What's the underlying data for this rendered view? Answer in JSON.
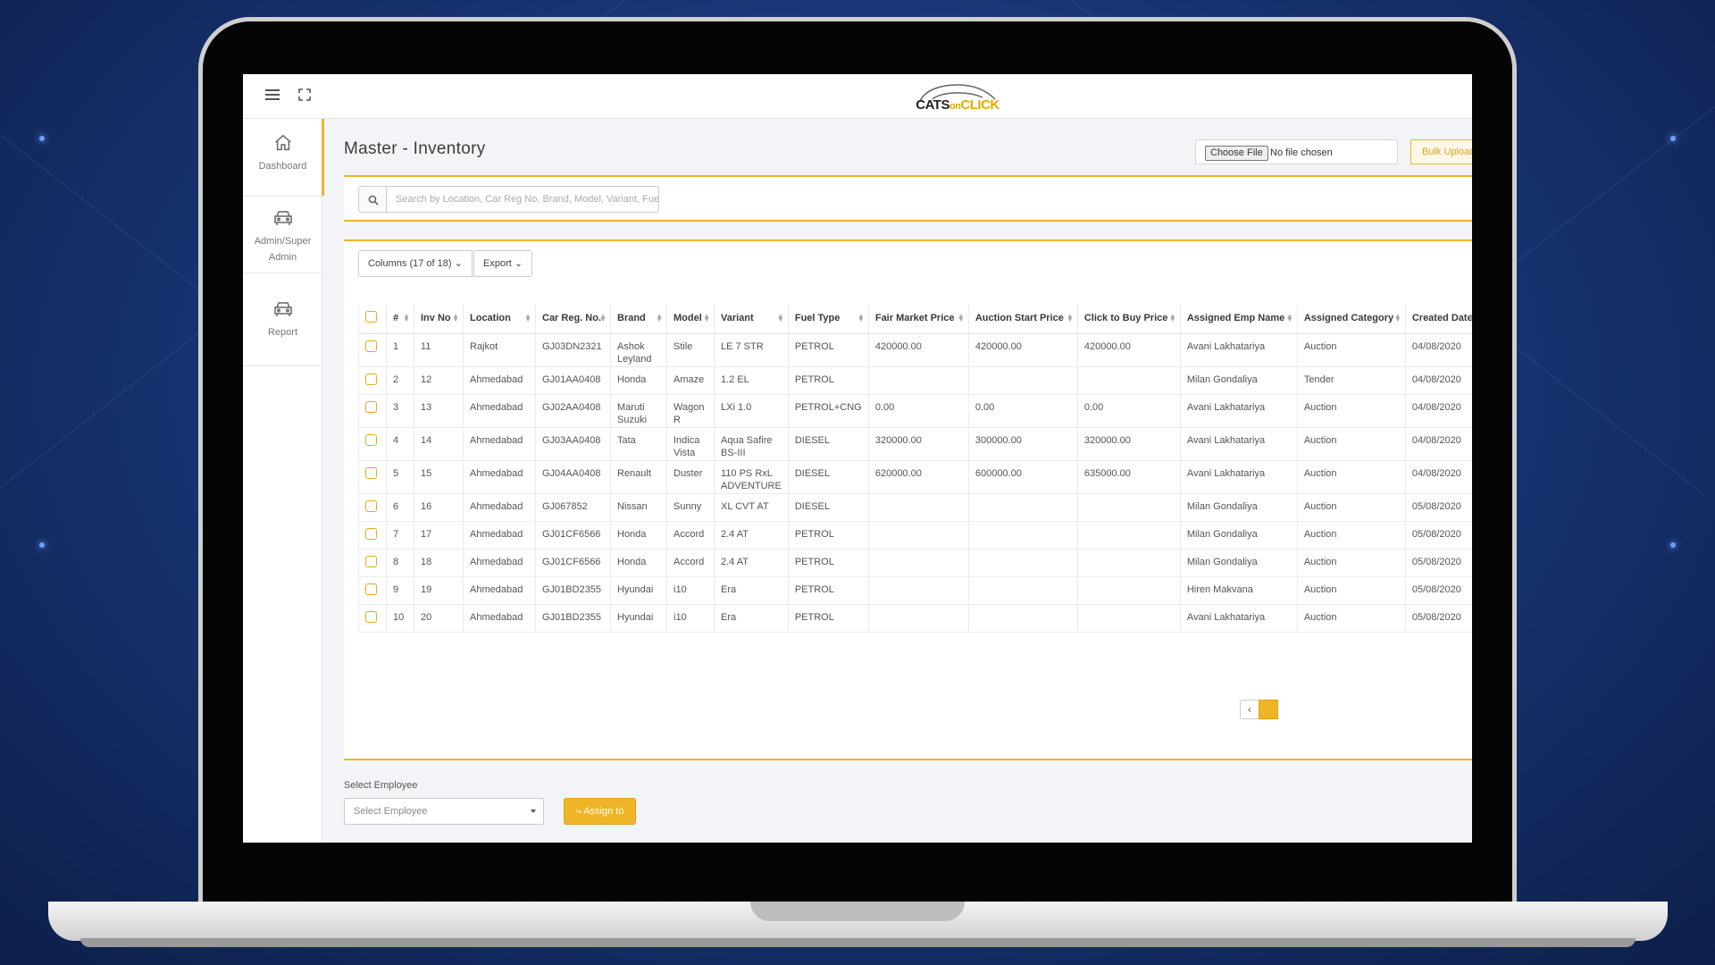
{
  "app": {
    "logo_text_part1": "CATS",
    "logo_text_part2": "on",
    "logo_text_part3": "CLICK"
  },
  "sidebar": {
    "items": [
      {
        "label": "Dashboard",
        "icon": "home-icon"
      },
      {
        "label": "Admin/Super Admin",
        "icon": "car-icon"
      },
      {
        "label": "Report",
        "icon": "car-icon"
      }
    ]
  },
  "page": {
    "title": "Master - Inventory",
    "file_button": "Choose File",
    "file_status": "No file chosen",
    "bulk_upload": "Bulk Upload"
  },
  "search": {
    "placeholder": "Search by Location, Car Reg No, Brand, Model, Variant, Fue"
  },
  "toolbar": {
    "columns_label": "Columns (17 of 18)",
    "export_label": "Export"
  },
  "table": {
    "headers": [
      "#",
      "Inv No",
      "Location",
      "Car Reg. No.",
      "Brand",
      "Model",
      "Variant",
      "Fuel Type",
      "Fair Market Price",
      "Auction Start Price",
      "Click to Buy Price",
      "Assigned Emp Name",
      "Assigned Category",
      "Created Date"
    ],
    "rows": [
      [
        "1",
        "11",
        "Rajkot",
        "GJ03DN2321",
        "Ashok Leyland",
        "Stile",
        "LE 7 STR",
        "PETROL",
        "420000.00",
        "420000.00",
        "420000.00",
        "Avani Lakhatariya",
        "Auction",
        "04/08/2020"
      ],
      [
        "2",
        "12",
        "Ahmedabad",
        "GJ01AA0408",
        "Honda",
        "Amaze",
        "1.2 EL",
        "PETROL",
        "",
        "",
        "",
        "Milan Gondaliya",
        "Tender",
        "04/08/2020"
      ],
      [
        "3",
        "13",
        "Ahmedabad",
        "GJ02AA0408",
        "Maruti Suzuki",
        "Wagon R",
        "LXi 1.0",
        "PETROL+CNG",
        "0.00",
        "0.00",
        "0.00",
        "Avani Lakhatariya",
        "Auction",
        "04/08/2020"
      ],
      [
        "4",
        "14",
        "Ahmedabad",
        "GJ03AA0408",
        "Tata",
        "Indica Vista",
        "Aqua Safire BS-III",
        "DIESEL",
        "320000.00",
        "300000.00",
        "320000.00",
        "Avani Lakhatariya",
        "Auction",
        "04/08/2020"
      ],
      [
        "5",
        "15",
        "Ahmedabad",
        "GJ04AA0408",
        "Renault",
        "Duster",
        "110 PS RxL ADVENTURE",
        "DIESEL",
        "620000.00",
        "600000.00",
        "635000.00",
        "Avani Lakhatariya",
        "Auction",
        "04/08/2020"
      ],
      [
        "6",
        "16",
        "Ahmedabad",
        "GJ067852",
        "Nissan",
        "Sunny",
        "XL CVT AT",
        "DIESEL",
        "",
        "",
        "",
        "Milan Gondaliya",
        "Auction",
        "05/08/2020"
      ],
      [
        "7",
        "17",
        "Ahmedabad",
        "GJ01CF6566",
        "Honda",
        "Accord",
        "2.4 AT",
        "PETROL",
        "",
        "",
        "",
        "Milan Gondaliya",
        "Auction",
        "05/08/2020"
      ],
      [
        "8",
        "18",
        "Ahmedabad",
        "GJ01CF6566",
        "Honda",
        "Accord",
        "2.4 AT",
        "PETROL",
        "",
        "",
        "",
        "Milan Gondaliya",
        "Auction",
        "05/08/2020"
      ],
      [
        "9",
        "19",
        "Ahmedabad",
        "GJ01BD2355",
        "Hyundai",
        "i10",
        "Era",
        "PETROL",
        "",
        "",
        "",
        "Hiren Makvana",
        "Auction",
        "05/08/2020"
      ],
      [
        "10",
        "20",
        "Ahmedabad",
        "GJ01BD2355",
        "Hyundai",
        "i10",
        "Era",
        "PETROL",
        "",
        "",
        "",
        "Avani Lakhatariya",
        "Auction",
        "05/08/2020"
      ]
    ]
  },
  "pager": {
    "prev_icon": "chevron-left-icon"
  },
  "assign": {
    "label": "Select Employee",
    "select_value": "Select Employee",
    "button": "Assign to"
  },
  "colors": {
    "accent": "#f0b429",
    "background": "#17326f"
  }
}
